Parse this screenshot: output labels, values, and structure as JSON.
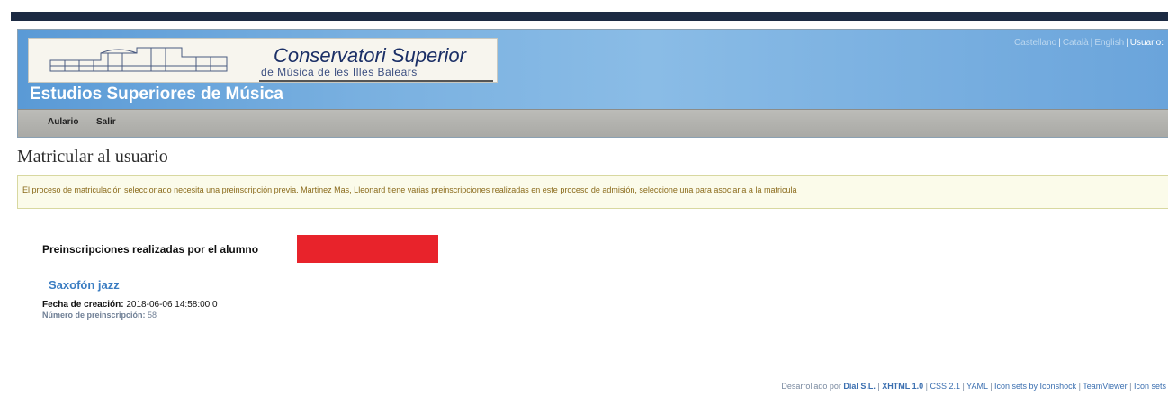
{
  "header": {
    "logo_title": "Conservatori Superior",
    "logo_subtitle": "de Música de les Illes Balears",
    "site_title": "Estudios Superiores de Música",
    "top_links": [
      "Castellano",
      "Català",
      "English"
    ],
    "user_label": "Usuario:"
  },
  "menu": {
    "items": [
      "Aulario",
      "Salir"
    ]
  },
  "page": {
    "title": "Matricular al usuario",
    "notice": "El proceso de matriculación seleccionado necesita una preinscripción previa. Martinez Mas, Lleonard tiene varias preinscripciones realizadas en este proceso de admisión, seleccione una para asociarla a la matricula",
    "section_title": "Preinscripciones realizadas por el alumno",
    "preinscription": {
      "name": "Saxofón jazz",
      "created_label": "Fecha de creación:",
      "created_value": "2018-06-06 14:58:00 0",
      "number_label": "Número de preinscripción:",
      "number_value": "58"
    }
  },
  "footer": {
    "prefix": "Desarrollado por",
    "links": [
      "Dial S.L.",
      "XHTML 1.0",
      "CSS 2.1",
      "YAML",
      "Icon sets by Iconshock",
      "TeamViewer",
      "Icon sets"
    ]
  },
  "colors": {
    "header_blue": "#6da4d6",
    "link_blue": "#3b7dc2",
    "redaction": "#e8232b",
    "notice_bg": "#fbfbea"
  }
}
